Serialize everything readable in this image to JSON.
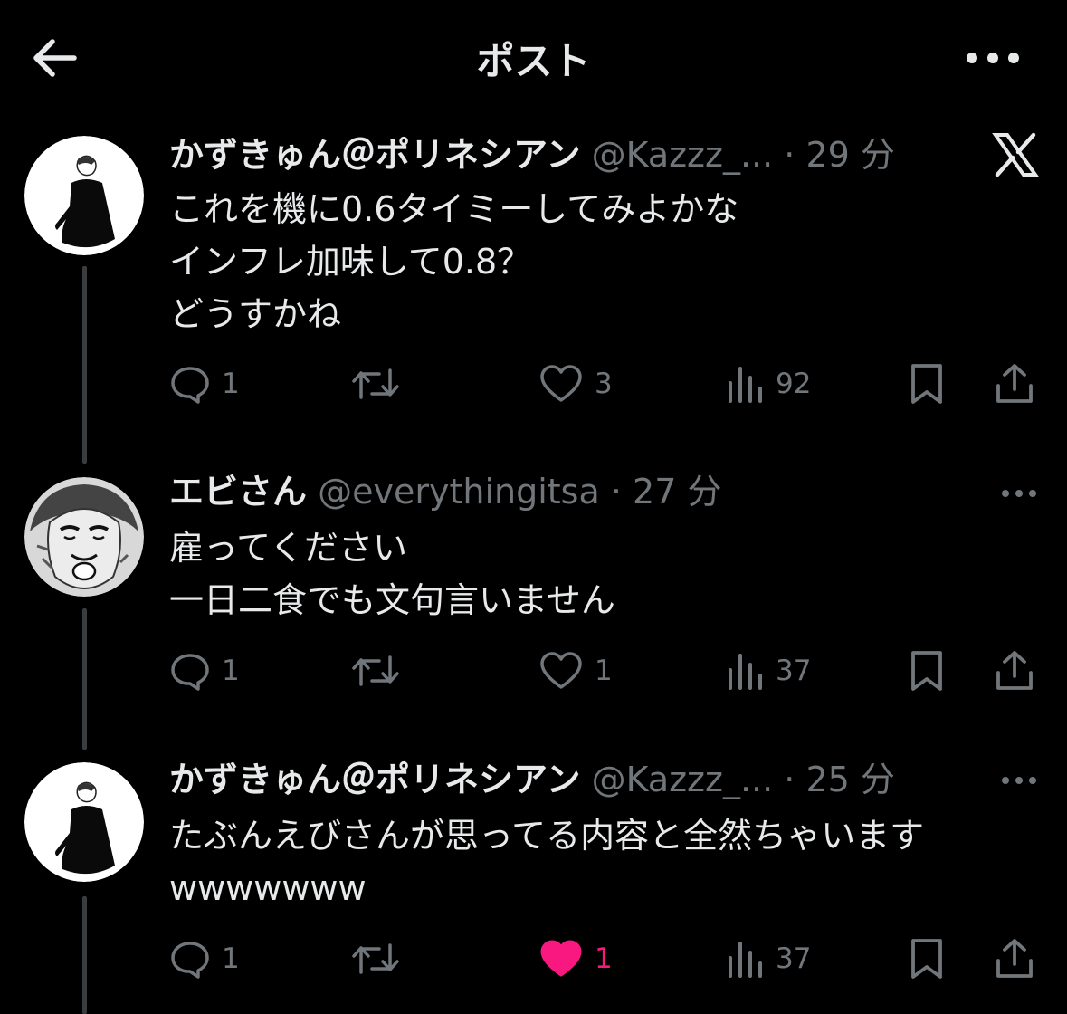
{
  "header": {
    "title": "ポスト"
  },
  "posts": [
    {
      "name": "かずきゅん＠ポリネシアン",
      "handle": "@Kazzz_...",
      "time": "· 29 分",
      "lines": [
        "これを機に0.6タイミーしてみよかな",
        "インフレ加味して0.8？",
        "どうすかね"
      ],
      "replies": "1",
      "reposts": "",
      "likes": "3",
      "views": "92"
    },
    {
      "name": "エビさん",
      "handle": "@everythingitsa",
      "time": "· 27 分",
      "lines": [
        "雇ってください",
        "一日二食でも文句言いません"
      ],
      "replies": "1",
      "reposts": "",
      "likes": "1",
      "views": "37"
    },
    {
      "name": "かずきゅん＠ポリネシアン",
      "handle": "@Kazzz_...",
      "time": "· 25 分",
      "lines": [
        "たぶんえびさんが思ってる内容と全然ちゃいます",
        "wwwwwww"
      ],
      "replies": "1",
      "reposts": "",
      "likes": "1",
      "views": "37",
      "liked": true
    }
  ],
  "icons": {
    "back": "arrow-left-icon",
    "more": "more-horizontal-icon",
    "x_logo": "x-logo-icon",
    "reply": "reply-icon",
    "repost": "repost-icon",
    "like": "heart-icon",
    "views": "views-chart-icon",
    "bookmark": "bookmark-icon",
    "share": "share-icon"
  },
  "colors": {
    "background": "#000000",
    "text": "#e7e9ea",
    "muted": "#71767b",
    "like": "#f91880"
  }
}
